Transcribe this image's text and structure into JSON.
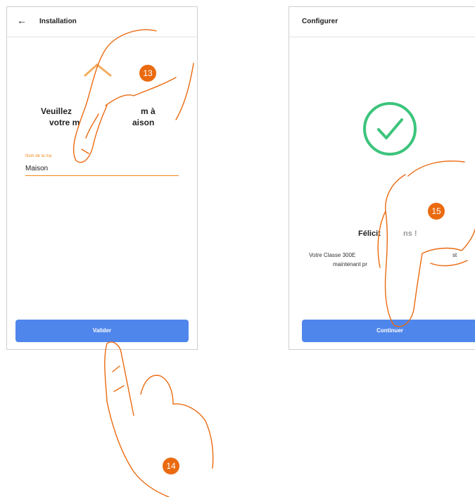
{
  "left_screen": {
    "header": {
      "back_glyph": "←",
      "back_icon": "back-arrow-icon",
      "title": "Installation"
    },
    "heading_line1": "Veuillez",
    "heading_line1_tail": "m à",
    "heading_line2": "votre m",
    "heading_line2_tail": "aison",
    "field": {
      "label": "Nom de la ma",
      "value": "Maison"
    },
    "button": {
      "label": "Valider"
    }
  },
  "right_screen": {
    "header": {
      "title": "Configurer"
    },
    "success_icon": "check-circle-icon",
    "heading": "Félicit",
    "heading_tail": "ns !",
    "body_line1_start": "Votre Classe 300E",
    "body_line1_end": "st",
    "body_line2": "maintenant pr",
    "button": {
      "label": "Continuer"
    }
  },
  "steps": [
    "13",
    "14",
    "15"
  ],
  "colors": {
    "accent_orange": "#f08a1c",
    "badge_orange": "#ea6a10",
    "button_blue": "#4f86ec",
    "success_green": "#3cc47c"
  }
}
